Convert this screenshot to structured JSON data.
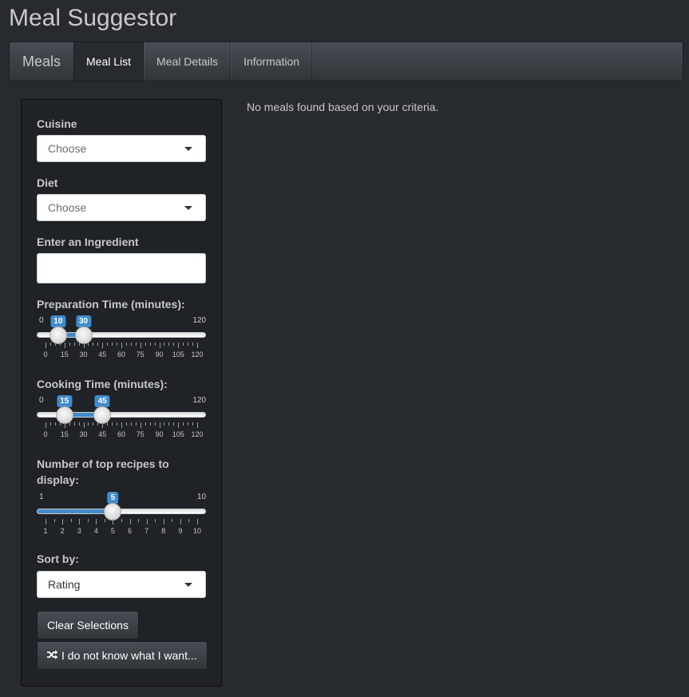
{
  "app": {
    "title": "Meal Suggestor"
  },
  "navbar": {
    "brand": "Meals",
    "tabs": [
      {
        "label": "Meal List",
        "active": true
      },
      {
        "label": "Meal Details",
        "active": false
      },
      {
        "label": "Information",
        "active": false
      }
    ]
  },
  "sidebar": {
    "cuisine": {
      "label": "Cuisine",
      "placeholder": "Choose"
    },
    "diet": {
      "label": "Diet",
      "placeholder": "Choose"
    },
    "ingredient": {
      "label": "Enter an Ingredient",
      "value": ""
    },
    "prep_time": {
      "label": "Preparation Time (minutes):",
      "min": "0",
      "max": "120",
      "low": "10",
      "high": "30",
      "tick_labels": [
        "0",
        "15",
        "30",
        "45",
        "60",
        "75",
        "90",
        "105",
        "120"
      ]
    },
    "cook_time": {
      "label": "Cooking Time (minutes):",
      "min": "0",
      "max": "120",
      "low": "15",
      "high": "45",
      "tick_labels": [
        "0",
        "15",
        "30",
        "45",
        "60",
        "75",
        "90",
        "105",
        "120"
      ]
    },
    "top_recipes": {
      "label": "Number of top recipes to display:",
      "min": "1",
      "max": "10",
      "value": "5",
      "tick_labels": [
        "1",
        "2",
        "3",
        "4",
        "5",
        "6",
        "7",
        "8",
        "9",
        "10"
      ]
    },
    "sort": {
      "label": "Sort by:",
      "value": "Rating"
    },
    "clear_button": "Clear Selections",
    "random_button": "I do not know what I want..."
  },
  "main": {
    "message": "No meals found based on your criteria."
  },
  "colors": {
    "accent": "#428bca",
    "background": "#272b30"
  }
}
